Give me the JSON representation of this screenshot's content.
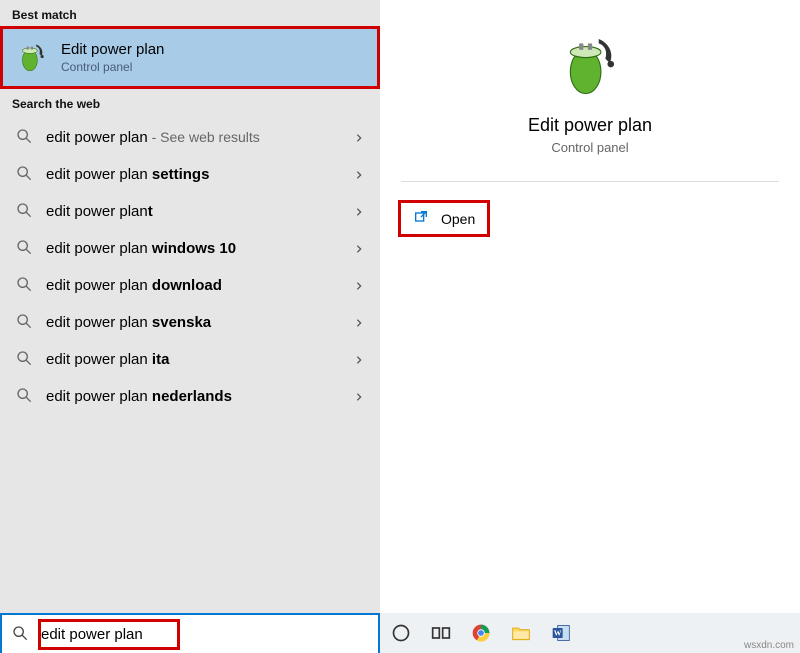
{
  "left": {
    "best_match_header": "Best match",
    "best_match": {
      "title": "Edit power plan",
      "subtitle": "Control panel"
    },
    "web_header": "Search the web",
    "web_results": [
      {
        "prefix": "edit power plan",
        "bold": "",
        "hint": " - See web results"
      },
      {
        "prefix": "edit power plan ",
        "bold": "settings",
        "hint": ""
      },
      {
        "prefix": "edit power plan",
        "bold": "t",
        "hint": ""
      },
      {
        "prefix": "edit power plan ",
        "bold": "windows 10",
        "hint": ""
      },
      {
        "prefix": "edit power plan ",
        "bold": "download",
        "hint": ""
      },
      {
        "prefix": "edit power plan ",
        "bold": "svenska",
        "hint": ""
      },
      {
        "prefix": "edit power plan ",
        "bold": "ita",
        "hint": ""
      },
      {
        "prefix": "edit power plan ",
        "bold": "nederlands",
        "hint": ""
      }
    ],
    "search_value": "edit power plan"
  },
  "right": {
    "title": "Edit power plan",
    "subtitle": "Control panel",
    "open_label": "Open"
  },
  "watermark": "wsxdn.com"
}
